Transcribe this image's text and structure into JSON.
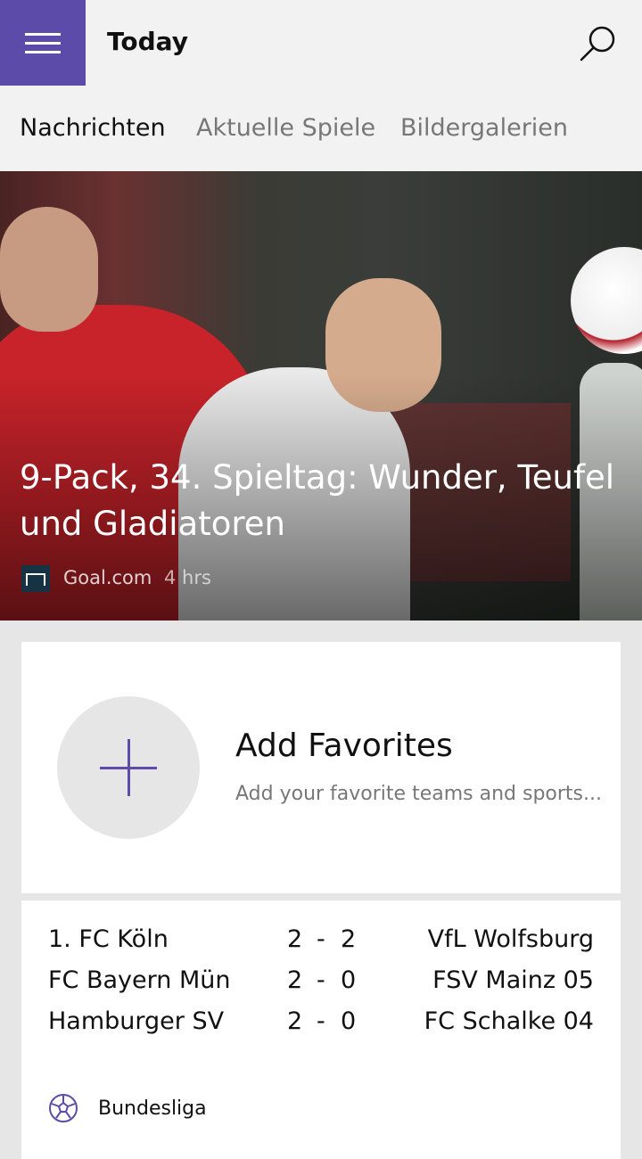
{
  "header": {
    "title": "Today",
    "menu_icon": "hamburger-menu-icon",
    "search_icon": "search-icon"
  },
  "tabs": [
    {
      "label": "Nachrichten",
      "active": true
    },
    {
      "label": "Aktuelle Spiele",
      "active": false
    },
    {
      "label": "Bildergalerien",
      "active": false
    }
  ],
  "hero": {
    "headline": "9-Pack, 34. Spieltag: Wunder, Teufel und Gladiatoren",
    "source": "Goal.com",
    "time": "4 hrs"
  },
  "favorites": {
    "title": "Add Favorites",
    "subtitle": "Add your favorite teams and sports..."
  },
  "scores": {
    "league": "Bundesliga",
    "matches": [
      {
        "home": "1. FC Köln",
        "home_score": "2",
        "sep": "-",
        "away_score": "2",
        "away": "VfL Wolfsburg"
      },
      {
        "home": "FC Bayern München",
        "home_score": "2",
        "sep": "-",
        "away_score": "0",
        "away": "FSV Mainz 05"
      },
      {
        "home": "Hamburger SV",
        "home_score": "2",
        "sep": "-",
        "away_score": "0",
        "away": "FC Schalke 04"
      }
    ]
  },
  "colors": {
    "accent": "#5c4ba9",
    "bar_bg": "#f2f2f2",
    "page_bg": "#e6e6e6"
  }
}
